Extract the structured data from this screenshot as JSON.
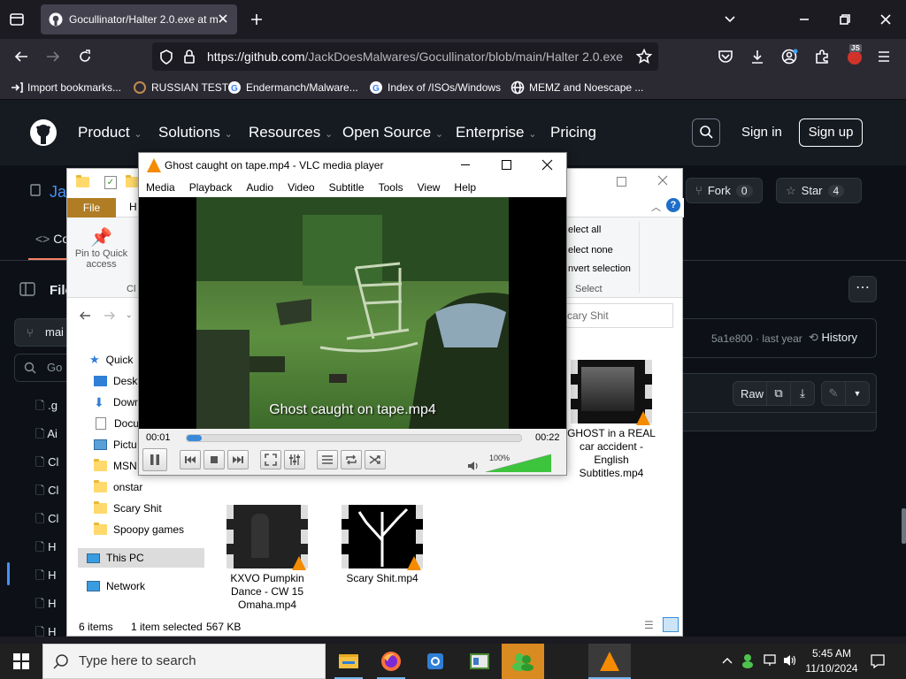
{
  "browser": {
    "tab_title": "Gocullinator/Halter 2.0.exe at m",
    "url_host": "https://github.com",
    "url_path": "/JackDoesMalwares/Gocullinator/blob/main/Halter 2.0.exe",
    "extension_badge": "JS",
    "bookmarks": [
      "Import bookmarks...",
      "RUSSIAN TEST",
      "Endermanch/Malware...",
      "Index of /ISOs/Windows",
      "MEMZ and Noescape ..."
    ]
  },
  "github": {
    "nav": [
      "Product",
      "Solutions",
      "Resources",
      "Open Source",
      "Enterprise",
      "Pricing"
    ],
    "sign_in": "Sign in",
    "sign_up": "Sign up",
    "repo_partial": "Ja",
    "fork_label": "Fork",
    "fork_count": "0",
    "star_label": "Star",
    "star_count": "4",
    "code_tab_partial": "Co",
    "files_partial": "File",
    "branch_partial": "mai",
    "goto_partial": "Go",
    "commit": "5a1e800 · last year",
    "history": "History",
    "raw": "Raw",
    "file_list_partial": [
      ".g",
      "Ai",
      "Cl",
      "Cl",
      "Cl",
      "H",
      "H",
      "H",
      "H"
    ]
  },
  "explorer": {
    "ribbon_file": "File",
    "ribbon_home_partial": "H",
    "pin_label": "Pin to Quick access",
    "clip_partial": "Cl",
    "select_all": "elect all",
    "select_none": "elect none",
    "invert": "nvert selection",
    "select_group": "Select",
    "search_placeholder": "cary Shit",
    "tree": [
      "Quick",
      "Deskt",
      "Down",
      "Docu",
      "Pictu",
      "MSN",
      "onstar",
      "Scary Shit",
      "Spoopy games",
      "This PC",
      "Network"
    ],
    "files": [
      {
        "name": "GHOST in a REAL car accident - English Subtitles.mp4"
      },
      {
        "name": "KXVO Pumpkin Dance - CW 15 Omaha.mp4"
      },
      {
        "name": "Scary Shit.mp4"
      }
    ],
    "status_items": "6 items",
    "status_selected": "1 item selected",
    "status_size": "567 KB"
  },
  "vlc": {
    "title": "Ghost caught on tape.mp4 - VLC media player",
    "menu": [
      "Media",
      "Playback",
      "Audio",
      "Video",
      "Subtitle",
      "Tools",
      "View",
      "Help"
    ],
    "subtitle_overlay": "Ghost caught on tape.mp4",
    "time_elapsed": "00:01",
    "time_total": "00:22",
    "progress": 0.045,
    "volume_label": "100%",
    "volume": 1.0
  },
  "taskbar": {
    "search_placeholder": "Type here to search",
    "time": "5:45 AM",
    "date": "11/10/2024"
  },
  "colors": {
    "firefox_bg": "#1c1b22",
    "github_header": "#161b22",
    "github_page": "#0d1117",
    "vlc_orange": "#f48b00",
    "volume_green": "#3cc43c",
    "taskbar": "#202020"
  }
}
